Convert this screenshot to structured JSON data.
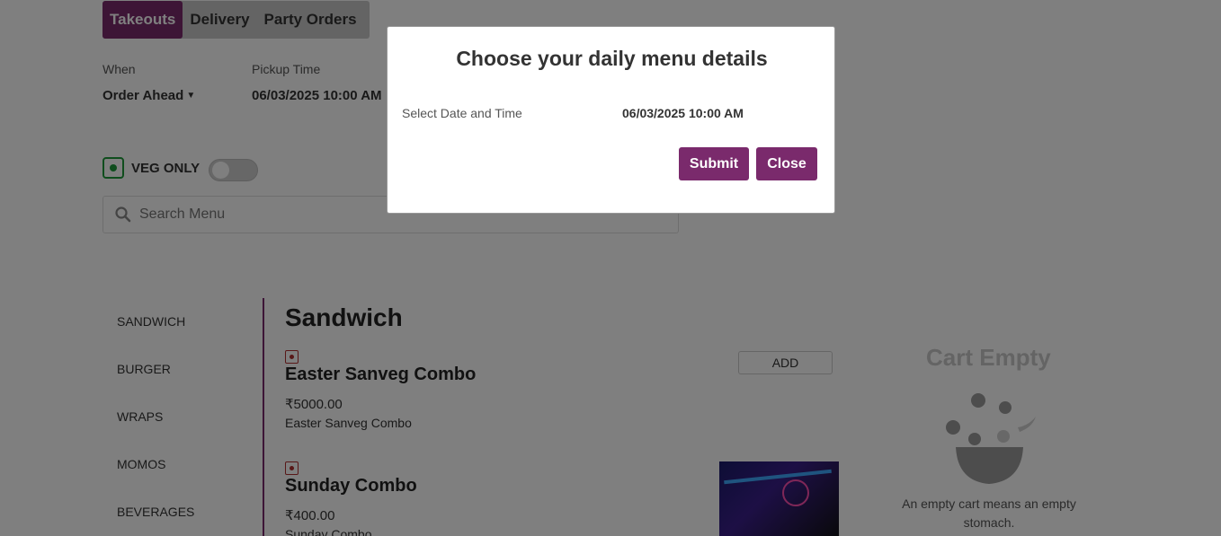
{
  "tabs": [
    {
      "label": "Takeouts",
      "active": true
    },
    {
      "label": "Delivery",
      "active": false
    },
    {
      "label": "Party Orders",
      "active": false
    }
  ],
  "order_options": {
    "when_label": "When",
    "when_value": "Order Ahead",
    "pickup_label": "Pickup Time",
    "pickup_value": "06/03/2025 10:00 AM"
  },
  "veg_filter": {
    "label": "VEG ONLY",
    "enabled": false
  },
  "search": {
    "placeholder": "Search Menu"
  },
  "categories": [
    "SANDWICH",
    "BURGER",
    "WRAPS",
    "MOMOS",
    "BEVERAGES"
  ],
  "menu": {
    "section_title": "Sandwich",
    "add_label": "ADD",
    "items": [
      {
        "name": "Easter Sanveg Combo",
        "price": "₹5000.00",
        "description": "Easter Sanveg Combo"
      },
      {
        "name": "Sunday Combo",
        "price": "₹400.00",
        "description": "Sunday Combo"
      }
    ]
  },
  "cart": {
    "title": "Cart Empty",
    "message": "An empty cart means an empty stomach."
  },
  "modal": {
    "title": "Choose your daily menu details",
    "date_label": "Select Date and Time",
    "date_value": "06/03/2025 10:00 AM",
    "submit_label": "Submit",
    "close_label": "Close"
  },
  "colors": {
    "brand": "#7a2a6c",
    "veg": "#1e9b3a",
    "non_veg": "#b03030",
    "overlay": "rgba(0,0,0,0.5)"
  }
}
